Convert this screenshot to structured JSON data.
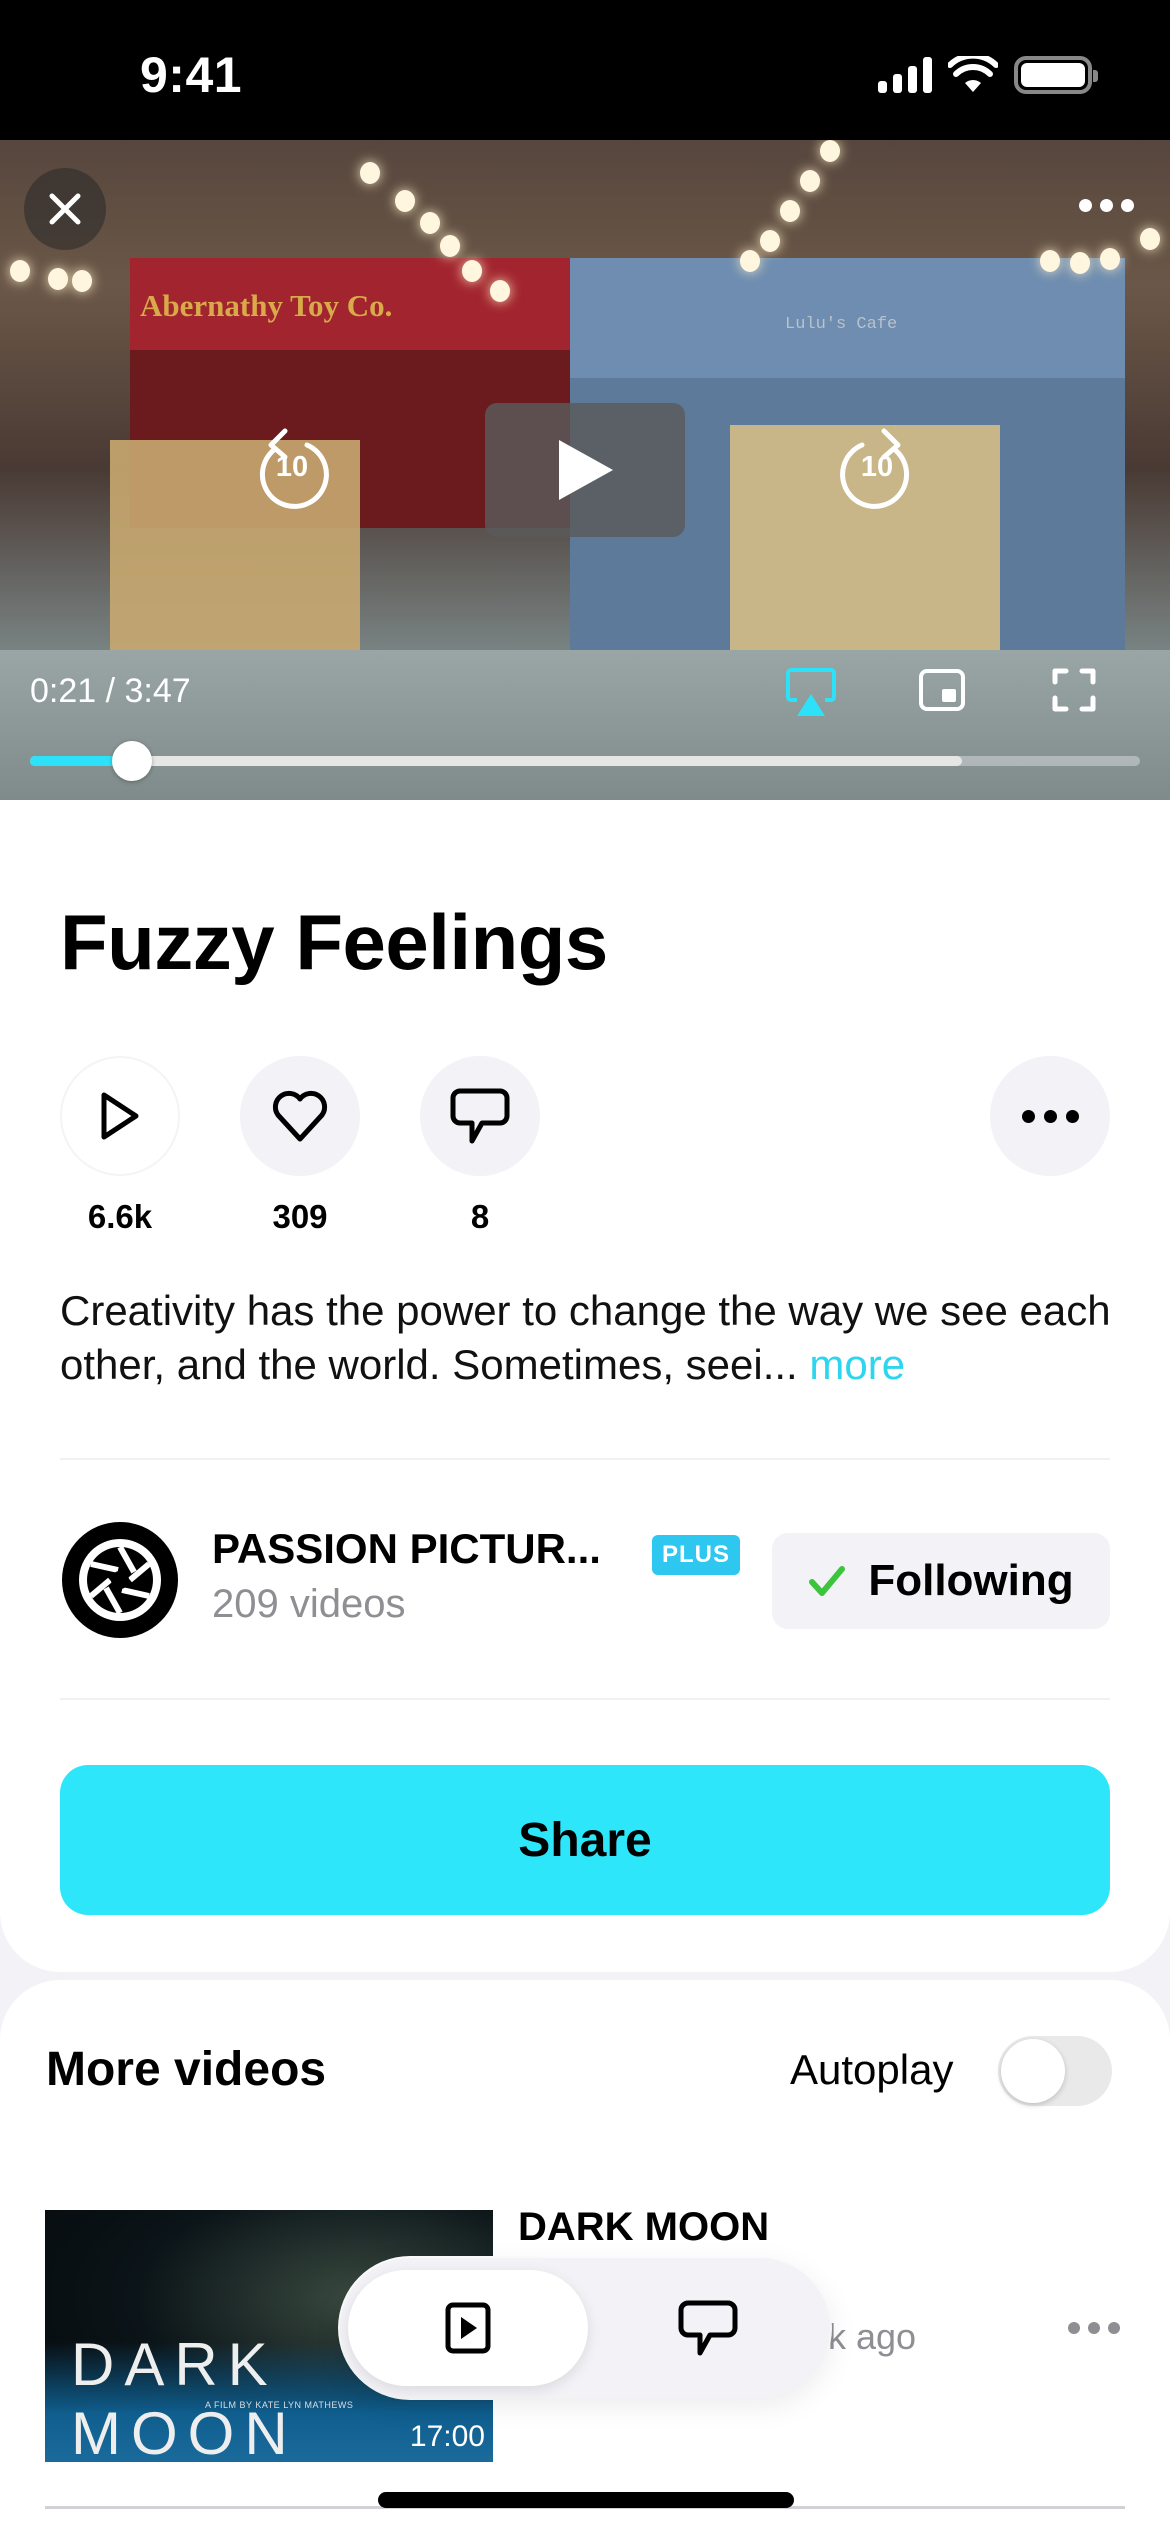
{
  "status_bar": {
    "time": "9:41"
  },
  "player": {
    "scene": {
      "left_shop_sign": "Abernathy Toy Co.",
      "right_shop_sign": "Lulu's Cafe"
    },
    "skip_back_seconds": "10",
    "skip_forward_seconds": "10",
    "current_time": "0:21",
    "duration": "3:47",
    "time_readout": "0:21 / 3:47",
    "progress_fraction": 0.092,
    "buffered_fraction": 0.84,
    "accent_color": "#2de2f8",
    "icons": {
      "close": "close-icon",
      "more": "more-horizontal-icon",
      "play": "play-icon",
      "skip_back": "skip-back-10-icon",
      "skip_forward": "skip-forward-10-icon",
      "airplay": "airplay-icon",
      "pip": "picture-in-picture-icon",
      "fullscreen": "fullscreen-icon"
    }
  },
  "video_info": {
    "title": "Fuzzy Feelings",
    "stats": [
      {
        "icon": "play-icon",
        "count": "6.6k"
      },
      {
        "icon": "heart-icon",
        "count": "309"
      },
      {
        "icon": "comment-icon",
        "count": "8"
      }
    ],
    "description": "Creativity has the power to change the way we see each other, and the world. Sometimes, seei...",
    "more_link": "more",
    "channel": {
      "name": "PASSION PICTUR...",
      "badge": "PLUS",
      "video_count": "209 videos",
      "follow_label": "Following"
    },
    "share_label": "Share",
    "share_color": "#2ee6f9"
  },
  "more_videos": {
    "title": "More videos",
    "autoplay_label": "Autoplay",
    "autoplay_on": false,
    "items": [
      {
        "title": "DARK MOON",
        "thumbnail_title": "DARK MOON",
        "thumbnail_subtitle": "A FILM BY KATE LYN MATHEWS",
        "duration": "17:00",
        "meta_partial": "k ago"
      }
    ]
  },
  "floating_tabs": [
    {
      "name": "video",
      "icon": "video-icon",
      "selected": true
    },
    {
      "name": "comments",
      "icon": "comment-icon",
      "selected": false
    }
  ]
}
